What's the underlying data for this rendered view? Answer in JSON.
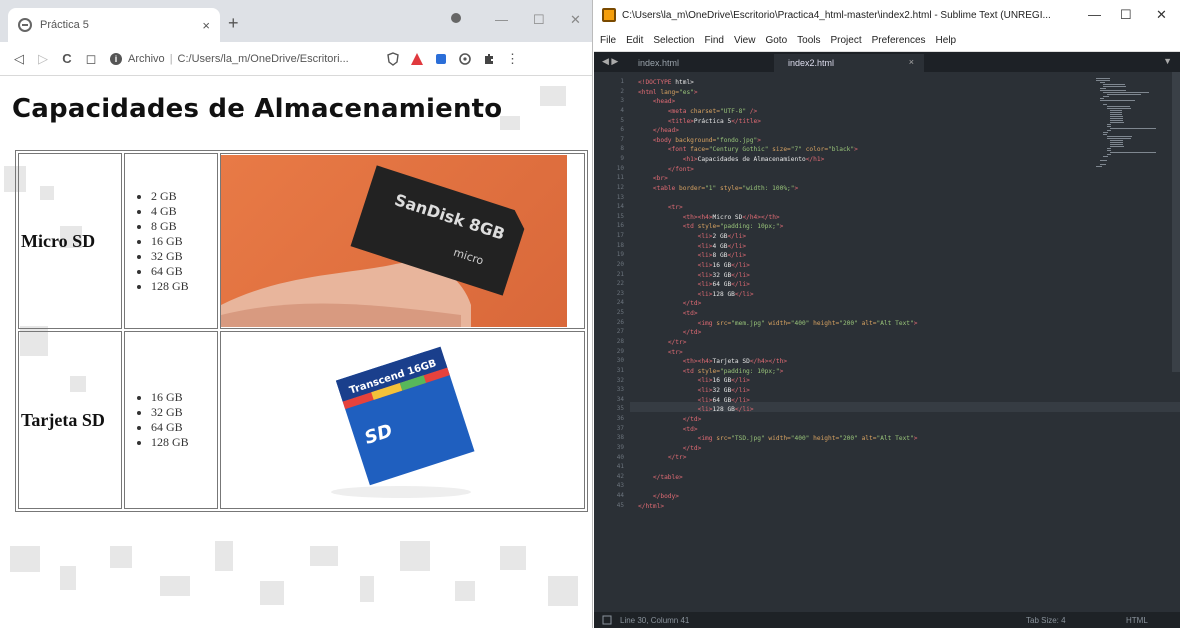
{
  "browser": {
    "tab_title": "Práctica 5",
    "tab_close": "×",
    "new_tab": "+",
    "minimize": "—",
    "maximize": "☐",
    "close": "✕",
    "nav_back": "◁",
    "nav_forward": "▷",
    "reload": "C",
    "bookmark": "◻",
    "address_scheme": "Archivo",
    "address_separator": "|",
    "address_path": "C:/Users/la_m/OneDrive/Escritori...",
    "menu": "⋮"
  },
  "page": {
    "heading": "Capacidades de Almacenamiento",
    "rows": [
      {
        "name": "Micro SD",
        "sizes": [
          "2 GB",
          "4 GB",
          "8 GB",
          "16 GB",
          "32 GB",
          "64 GB",
          "128 GB"
        ],
        "image_label": "SanDisk 8GB"
      },
      {
        "name": "Tarjeta SD",
        "sizes": [
          "16 GB",
          "32 GB",
          "64 GB",
          "128 GB"
        ],
        "image_label": "Transcend 16GB"
      }
    ]
  },
  "sublime": {
    "title": "C:\\Users\\la_m\\OneDrive\\Escritorio\\Practica4_html-master\\index2.html - Sublime Text (UNREGI...",
    "menu": [
      "File",
      "Edit",
      "Selection",
      "Find",
      "View",
      "Goto",
      "Tools",
      "Project",
      "Preferences",
      "Help"
    ],
    "tabs": [
      "index.html",
      "index2.html"
    ],
    "tab_arrows": "◀ ▶",
    "tab_close": "×",
    "tab_dropdown": "▼",
    "status_left": "Line 30, Column 41",
    "status_tab": "Tab Size: 4",
    "status_lang": "HTML"
  },
  "code_lines": [
    "<!DOCTYPE html>",
    "<html lang=\"es\">",
    "    <head>",
    "        <meta charset=\"UTF-8\" />",
    "        <title>Práctica 5</title>",
    "    </head>",
    "    <body background=\"fondo.jpg\">",
    "        <font face=\"Century Gothic\" size=\"7\" color=\"black\">",
    "            <h1>Capacidades de Almacenamiento</h1>",
    "        </font>",
    "    <br>",
    "    <table border=\"1\" style=\"width: 100%;\">",
    "",
    "        <tr>",
    "            <th><h4>Micro SD</h4></th>",
    "            <td style=\"padding: 10px;\">",
    "                <li>2 GB</li>",
    "                <li>4 GB</li>",
    "                <li>8 GB</li>",
    "                <li>16 GB</li>",
    "                <li>32 GB</li>",
    "                <li>64 GB</li>",
    "                <li>128 GB</li>",
    "            </td>",
    "            <td>",
    "                <img src=\"mem.jpg\" width=\"400\" height=\"200\" alt=\"Alt Text\">",
    "            </td>",
    "        </tr>",
    "        <tr>",
    "            <th><h4>Tarjeta SD</h4></th>",
    "            <td style=\"padding: 10px;\">",
    "                <li>16 GB</li>",
    "                <li>32 GB</li>",
    "                <li>64 GB</li>",
    "                <li>128 GB</li>",
    "            </td>",
    "            <td>",
    "                <img src=\"TSD.jpg\" width=\"400\" height=\"200\" alt=\"Alt Text\">",
    "            </td>",
    "        </tr>",
    "",
    "    </table>",
    "",
    "    </body>",
    "</html>"
  ],
  "colors": {
    "editor_bg": "#2b3036",
    "tag": "#e06b74",
    "attr": "#d7a261",
    "string": "#98c379",
    "orange_photo_bg": "#e07a45"
  }
}
